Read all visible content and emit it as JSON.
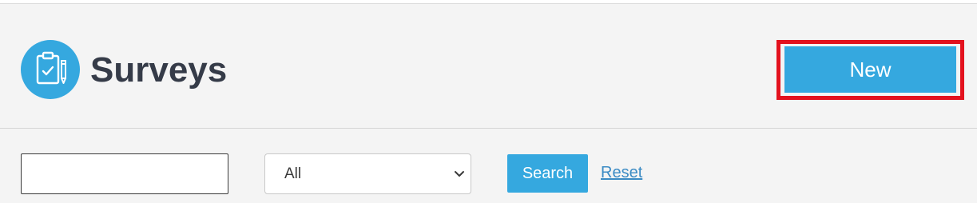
{
  "header": {
    "title": "Surveys",
    "icon": "clipboard-check-icon",
    "new_button_label": "New"
  },
  "filters": {
    "search_value": "",
    "type_select": {
      "selected": "All"
    },
    "search_button_label": "Search",
    "reset_link_label": "Reset"
  },
  "colors": {
    "accent": "#35a8df",
    "title_text": "#353b48",
    "highlight_border": "#e3121e",
    "link": "#3b8bc4"
  }
}
